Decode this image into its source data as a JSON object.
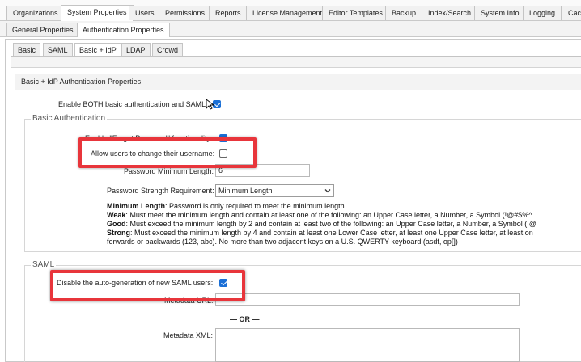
{
  "top_tabs": [
    {
      "label": "Organizations",
      "active": false
    },
    {
      "label": "System Properties",
      "active": true
    },
    {
      "label": "Users",
      "active": false
    },
    {
      "label": "Permissions",
      "active": false
    },
    {
      "label": "Reports",
      "active": false
    },
    {
      "label": "License Management",
      "active": false
    },
    {
      "label": "Editor Templates",
      "active": false
    },
    {
      "label": "Backup",
      "active": false
    },
    {
      "label": "Index/Search",
      "active": false
    },
    {
      "label": "System Info",
      "active": false
    },
    {
      "label": "Logging",
      "active": false
    },
    {
      "label": "Cac",
      "active": false
    }
  ],
  "sub_tabs": [
    {
      "label": "General Properties",
      "active": false
    },
    {
      "label": "Authentication Properties",
      "active": true
    }
  ],
  "auth_tabs": [
    {
      "label": "Basic",
      "active": false
    },
    {
      "label": "SAML",
      "active": false
    },
    {
      "label": "Basic + IdP",
      "active": true
    },
    {
      "label": "LDAP",
      "active": false
    },
    {
      "label": "Crowd",
      "active": false
    }
  ],
  "section_title": "Basic + IdP Authentication Properties",
  "enable_both": {
    "label": "Enable BOTH basic authentication and SAML:",
    "checked": true
  },
  "basic_auth": {
    "legend": "Basic Authentication",
    "forgot_password": {
      "label": "Enable \"Forgot Password\" functionality:",
      "checked": true
    },
    "change_username": {
      "label": "Allow users to change their username:",
      "checked": false
    },
    "min_length": {
      "label": "Password Minimum Length:",
      "value": "6"
    },
    "strength": {
      "label": "Password Strength Requirement:",
      "selected": "Minimum Length"
    },
    "descriptions": [
      {
        "term": "Minimum Length",
        "text": ": Password is only required to meet the minimum length."
      },
      {
        "term": "Weak",
        "text": ": Must meet the minimum length and contain at least one of the following: an Upper Case letter, a Number, a Symbol (!@#$%^"
      },
      {
        "term": "Good",
        "text": ": Must exceed the minimum length by 2 and contain at least two of the following: an Upper Case letter, a Number, a Symbol (!@"
      },
      {
        "term": "Strong",
        "text": ": Must exceed the minimum length by 4 and contain at least one Lower Case letter, at least one Upper Case letter, at least on"
      },
      {
        "term": "",
        "text": "forwards or backwards (123, abc). No more than two adjacent keys on a U.S. QWERTY keyboard (asdf, op[])"
      }
    ]
  },
  "saml": {
    "legend": "SAML",
    "disable_autogen": {
      "label": "Disable the auto-generation of new SAML users:",
      "checked": true
    },
    "metadata_url": {
      "label": "Metadata URL:",
      "value": ""
    },
    "or_divider": "— OR —",
    "metadata_xml": {
      "label": "Metadata XML:",
      "value": ""
    }
  },
  "colors": {
    "highlight": "#e8353b",
    "checkbox_checked": "#1a6fd6"
  }
}
